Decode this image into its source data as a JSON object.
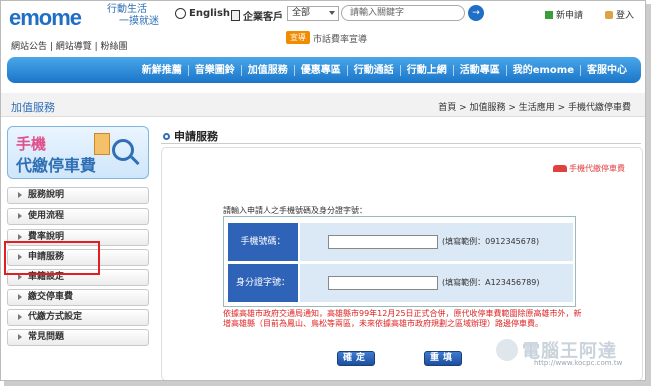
{
  "header": {
    "logo": "emome",
    "slogan_line1": "行動生活",
    "slogan_line2": "一摸就迷",
    "english_link": "English",
    "enterprise_link": "企業客戶",
    "scope_select": "全部",
    "search_placeholder": "請輸入關鍵字",
    "search_button": "→",
    "new_apply": "新申請",
    "login": "登入"
  },
  "subnav": {
    "links": "網站公告 | 網站導覽 | 粉絲團",
    "promo_badge": "宣導",
    "promo_text": "市話費率宣導"
  },
  "main_nav": {
    "items": [
      "新鮮推薦",
      "音樂圖鈴",
      "加值服務",
      "優惠專區",
      "行動通話",
      "行動上網",
      "活動專區",
      "我的emome",
      "客服中心"
    ]
  },
  "section": {
    "title": "加值服務",
    "breadcrumb": "首頁 > 加值服務 > 生活應用 > 手機代繳停車費"
  },
  "sidebar": {
    "banner_line1": "手機",
    "banner_line2": "代繳停車費",
    "items": [
      {
        "label": "服務說明"
      },
      {
        "label": "使用流程"
      },
      {
        "label": "費率說明"
      },
      {
        "label": "申請服務"
      },
      {
        "label": "車籍設定"
      },
      {
        "label": "繳交停車費"
      },
      {
        "label": "代繳方式設定"
      },
      {
        "label": "常見問題"
      }
    ]
  },
  "content": {
    "title": "申請服務",
    "brand_tag": "手機代繳停車費",
    "instruction": "請輸入申請人之手機號碼及身分證字號：",
    "phone_label": "手機號碼：",
    "phone_hint": "(填寫範例：0912345678)",
    "id_label": "身分證字號：",
    "id_hint": "(填寫範例：A123456789)",
    "note": "依據高雄市政府交通局通知，高雄縣市99年12月25日正式合併，原代收停車費範圍除原高雄市外，新增高雄縣（目前為鳳山、鳥松等兩區，未來依據高雄市政府規劃之區域辦理）路邊停車費。",
    "confirm_button": "確定",
    "reset_button": "重填"
  },
  "watermark": {
    "title": "電腦王阿達",
    "url": "http://www.kocpc.com.tw"
  }
}
